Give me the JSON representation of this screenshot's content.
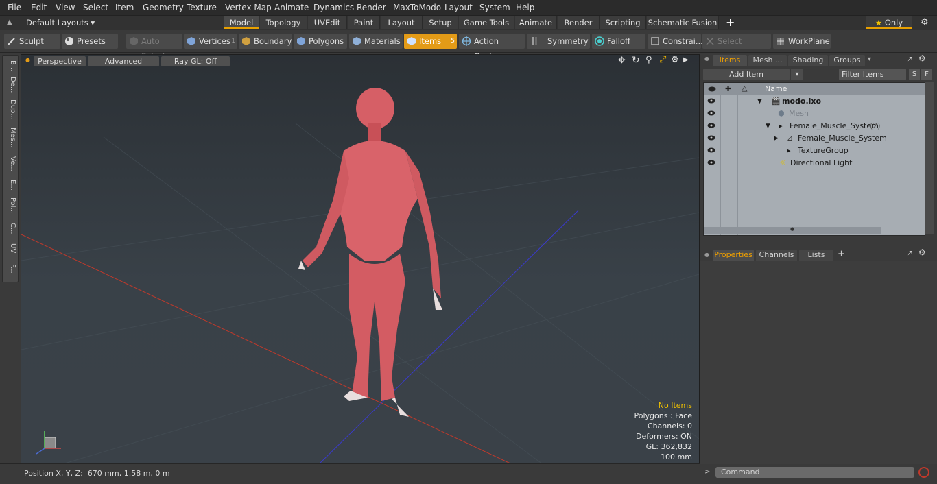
{
  "menu": [
    "File",
    "Edit",
    "View",
    "Select",
    "Item",
    "Geometry",
    "Texture",
    "Vertex Map",
    "Animate",
    "Dynamics",
    "Render",
    "MaxToModo",
    "Layout",
    "System",
    "Help"
  ],
  "layout_selector": "Default Layouts",
  "layout_tabs": [
    "Model",
    "Topology",
    "UVEdit",
    "Paint",
    "Layout",
    "Setup",
    "Game Tools",
    "Animate",
    "Render",
    "Scripting",
    "Schematic Fusion"
  ],
  "only_label": "Only",
  "toolbar": {
    "sculpt": "Sculpt",
    "presets": "Presets",
    "auto_select": "Auto Select",
    "vertices": "Vertices",
    "vertices_count": "1",
    "boundary": "Boundary",
    "polygons": "Polygons",
    "materials": "Materials",
    "items": "Items",
    "items_count": "5",
    "action_center": "Action Center",
    "symmetry": "Symmetry",
    "falloff": "Falloff",
    "constraints": "Constrai...",
    "select_through": "Select Through",
    "workplane": "WorkPlane"
  },
  "left_tabs": [
    "B...",
    "De...",
    "Dup...",
    "Mes...",
    "Ve...",
    "E...",
    "Pol...",
    "C...",
    "UV",
    "F..."
  ],
  "viewport": {
    "view_mode": "Perspective",
    "shading": "Advanced",
    "ray_gl": "Ray GL: Off",
    "stats": {
      "selection": "No Items",
      "polygons": "Polygons : Face",
      "channels": "Channels: 0",
      "deformers": "Deformers: ON",
      "gl": "GL: 362,832",
      "scale": "100 mm"
    }
  },
  "status": {
    "position": "Position X, Y, Z:  670 mm, 1.58 m, 0 m"
  },
  "items_panel": {
    "tabs": [
      "Items",
      "Mesh ...",
      "Shading",
      "Groups"
    ],
    "add_item": "Add Item",
    "filter": "Filter Items",
    "btn_s": "S",
    "btn_f": "F",
    "column_name": "Name",
    "tree": [
      {
        "label": "modo.lxo",
        "count": ""
      },
      {
        "label": "Mesh",
        "count": ""
      },
      {
        "label": "Female_Muscle_System",
        "count": "(2)"
      },
      {
        "label": "Female_Muscle_System",
        "count": ""
      },
      {
        "label": "TextureGroup",
        "count": ""
      },
      {
        "label": "Directional Light",
        "count": ""
      }
    ]
  },
  "properties_panel": {
    "tabs": [
      "Properties",
      "Channels",
      "Lists"
    ]
  },
  "command": {
    "placeholder": "Command"
  },
  "colors": {
    "accent": "#e39b17",
    "x_axis": "#c0392b",
    "z_axis": "#3a3acb",
    "muscle": "#d9636a"
  }
}
